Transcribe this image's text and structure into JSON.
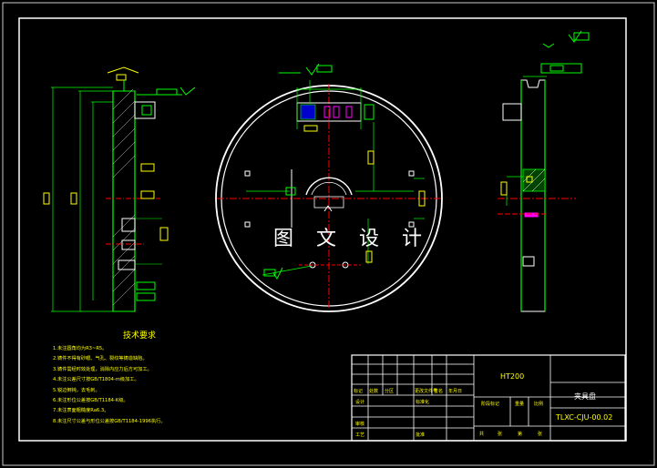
{
  "watermark": "图 文 设 计",
  "technical_requirements": {
    "title": "技术要求",
    "items": [
      "1.未注圆角均为R3~R5。",
      "2.铸件不得有砂眼、气孔、裂纹等铸造缺陷。",
      "3.铸件需经时效处理，消除内应力后方可加工。",
      "4.未注公差尺寸按GB/T1804-m级加工。",
      "5.锐边倒钝，去毛刺。",
      "6.未注形位公差按GB/T1184-K级。",
      "7.未注表面粗糙度Ra6.3。",
      "8.未注尺寸公差与形位公差按GB/T1184-1996执行。"
    ]
  },
  "title_block": {
    "material": "HT200",
    "part_name": "夹具盘",
    "drawing_number": "TLXC-CJU-00.02",
    "header_labels": [
      "标记",
      "处数",
      "分区",
      "更改文件号",
      "签名",
      "年月日"
    ],
    "row_labels": [
      "设计",
      "标准化",
      "审核",
      "工艺",
      "批准"
    ],
    "stage_labels": [
      "阶段标记",
      "重量",
      "比例"
    ],
    "sheet_labels": [
      "共",
      "张",
      "第",
      "张"
    ]
  },
  "colors": {
    "outline": "#ffffff",
    "part": "#00ff00",
    "dimension": "#ffff00",
    "centerline": "#ff0000",
    "symbol": "#00ffff",
    "accent": "#ff00ff"
  }
}
